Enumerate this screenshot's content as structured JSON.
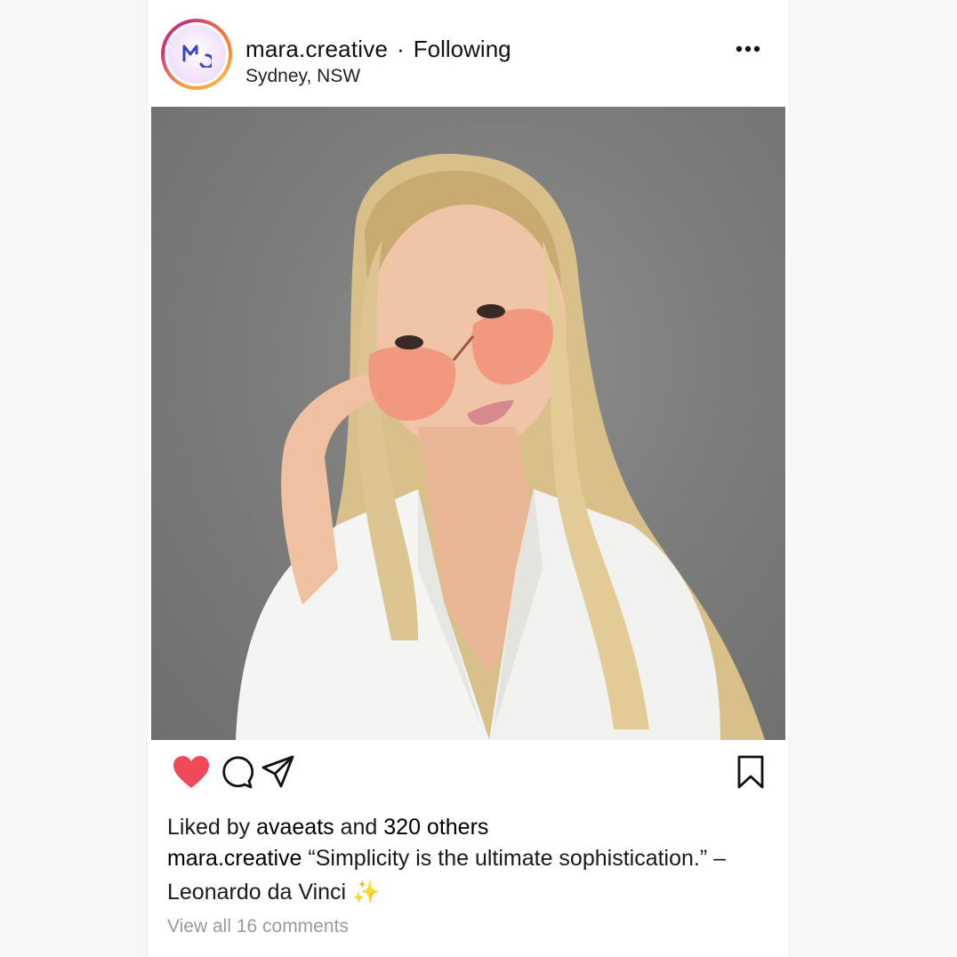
{
  "header": {
    "username": "mara.creative",
    "separator": "·",
    "follow_status": "Following",
    "location": "Sydney, NSW",
    "avatar_icon": "mc-monogram-logo",
    "more_icon": "more-horizontal-icon"
  },
  "post": {
    "image_alt": "photo"
  },
  "actions": {
    "like_icon": "heart-icon",
    "comment_icon": "comment-icon",
    "share_icon": "send-icon",
    "save_icon": "bookmark-icon",
    "liked": true
  },
  "likes": {
    "prefix": "Liked by",
    "user": "avaeats",
    "conjunction": "and",
    "others": "320 others"
  },
  "caption": {
    "user": "mara.creative",
    "text": "“Simplicity is the ultimate sophistication.” – Leonardo da Vinci ✨"
  },
  "comments": {
    "link": "View all 16 comments"
  },
  "colors": {
    "like": "#f04a5a",
    "muted": "#9a9a9a",
    "logo_blue": "#3540d8",
    "background": "#f7f7f7"
  }
}
